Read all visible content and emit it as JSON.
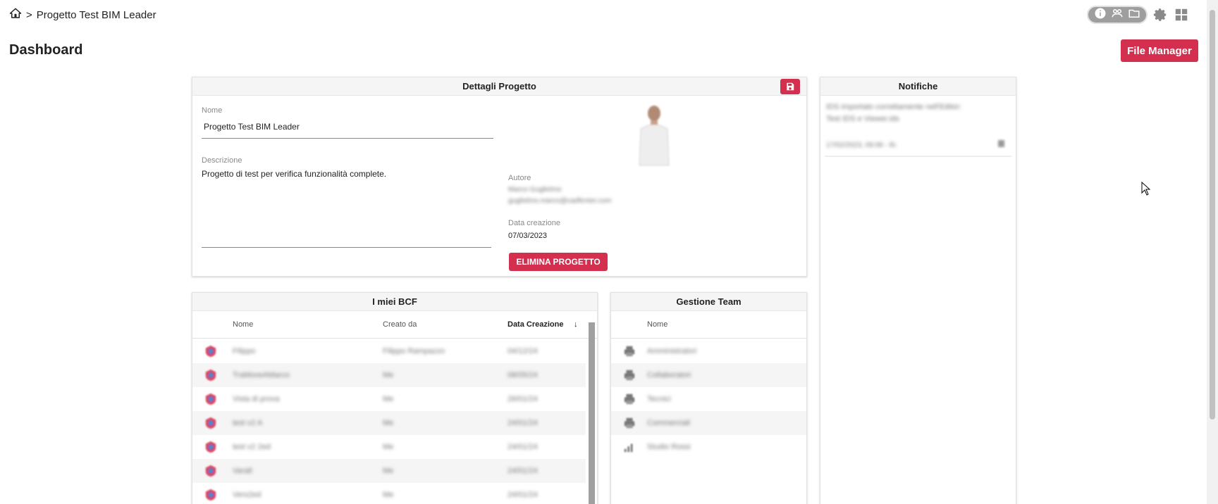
{
  "breadcrumb": {
    "separator": ">",
    "current": "Progetto Test BIM Leader"
  },
  "page": {
    "title": "Dashboard",
    "file_manager_label": "File Manager"
  },
  "dettagli": {
    "header": "Dettagli Progetto",
    "nome_label": "Nome",
    "nome_value": "Progetto Test BIM Leader",
    "descrizione_label": "Descrizione",
    "descrizione_value": "Progetto di test per verifica funzionalità complete.",
    "autore_label": "Autore",
    "autore_name": "Marco Guglielmo",
    "autore_email": "guglielmo.marco@cadfenter.com",
    "data_label": "Data creazione",
    "data_value": "07/03/2023",
    "delete_label": "ELIMINA PROGETTO"
  },
  "notifiche": {
    "header": "Notifiche",
    "items": [
      {
        "line1": "IDS importato correttamente nell'Editor:",
        "line2": "Test IDS e Viewer.ids",
        "date": "17/02/2023, 09:08 - ifc"
      }
    ]
  },
  "bcf": {
    "header": "I miei BCF",
    "columns": {
      "nome": "Nome",
      "creato": "Creato da",
      "data": "Data Creazione",
      "sort_arrow": "↓"
    },
    "rows": [
      {
        "nome": "Filippo",
        "creato": "Filippo Rampazzo",
        "data": "04/12/24"
      },
      {
        "nome": "TraMoveAMarco",
        "creato": "Me",
        "data": "08/05/24"
      },
      {
        "nome": "Vista di prova",
        "creato": "Me",
        "data": "26/01/24"
      },
      {
        "nome": "test v2 A",
        "creato": "Me",
        "data": "24/01/24"
      },
      {
        "nome": "test v2 2ed",
        "creato": "Me",
        "data": "24/01/24"
      },
      {
        "nome": "Varalt",
        "creato": "Me",
        "data": "24/01/24"
      },
      {
        "nome": "Vers2ed",
        "creato": "Me",
        "data": "24/01/24"
      }
    ]
  },
  "gestione": {
    "header": "Gestione Team",
    "column_nome": "Nome",
    "rows": [
      {
        "nome": "Amministratori",
        "icon": "printer-icon"
      },
      {
        "nome": "Collaboratori",
        "icon": "printer-icon"
      },
      {
        "nome": "Tecnici",
        "icon": "printer-icon"
      },
      {
        "nome": "Commerciali",
        "icon": "printer-icon"
      },
      {
        "nome": "Studio Rossi",
        "icon": "signal-icon"
      }
    ]
  },
  "colors": {
    "accent": "#d32f4f",
    "header_bg": "#f5f5f5",
    "row_alt": "#f5f5f5"
  }
}
